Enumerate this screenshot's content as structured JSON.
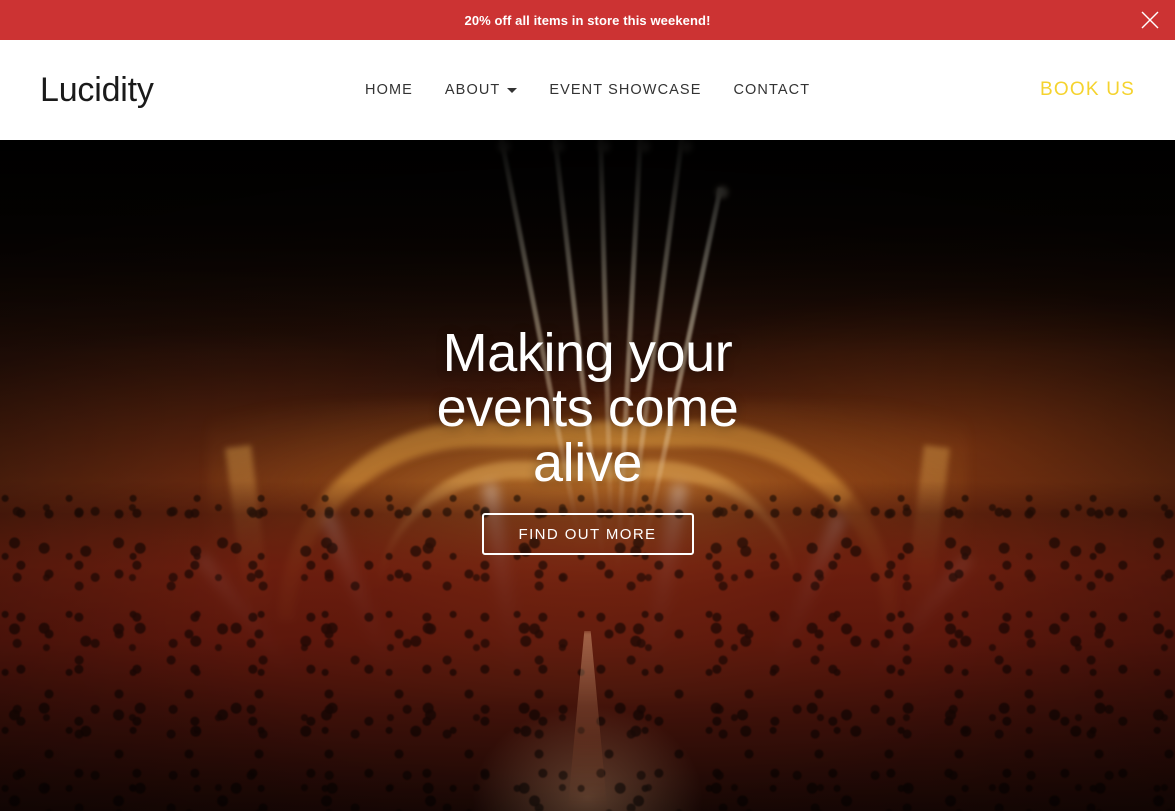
{
  "promo_banner": {
    "text": "20% off all items in store this weekend!",
    "background_color": "#CC3333",
    "text_color": "#FFFFFF",
    "close_icon": "close-icon"
  },
  "header": {
    "brand": "Lucidity",
    "nav": [
      {
        "label": "HOME",
        "has_dropdown": false
      },
      {
        "label": "ABOUT",
        "has_dropdown": true,
        "dropdown_icon": "chevron-down-icon"
      },
      {
        "label": "EVENT SHOWCASE",
        "has_dropdown": false
      },
      {
        "label": "CONTACT",
        "has_dropdown": false
      }
    ],
    "cta": {
      "label": "BOOK US",
      "color": "#F5D32E"
    },
    "background_color": "#FFFFFF",
    "nav_text_color": "#333333"
  },
  "hero": {
    "title": "Making your events come alive",
    "cta_label": "FIND OUT MORE",
    "image_description": "Outdoor music festival at night: white pyrotechnic sparkler beams fall from above onto a large golden ornate stage, with a vast crowd of silhouetted people lit in warm red and orange.",
    "title_color": "#FFFFFF",
    "accent_glow_color": "#7A3312",
    "dark_color": "#0B0603"
  }
}
